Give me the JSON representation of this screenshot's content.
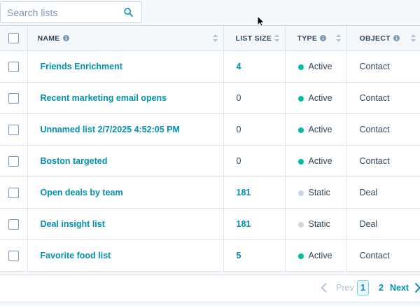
{
  "search": {
    "placeholder": "Search lists",
    "value": ""
  },
  "table": {
    "columns": [
      {
        "label": "NAME",
        "info": true
      },
      {
        "label": "LIST SIZE",
        "info": false
      },
      {
        "label": "TYPE",
        "info": true
      },
      {
        "label": "OBJECT",
        "info": true
      }
    ],
    "rows": [
      {
        "name": "Friends Enrichment",
        "size": "4",
        "size_link": true,
        "type": "Active",
        "object": "Contact"
      },
      {
        "name": "Recent marketing email opens",
        "size": "0",
        "size_link": false,
        "type": "Active",
        "object": "Contact"
      },
      {
        "name": "Unnamed list 2/7/2025 4:52:05 PM",
        "size": "0",
        "size_link": false,
        "type": "Active",
        "object": "Contact"
      },
      {
        "name": "Boston targeted",
        "size": "0",
        "size_link": false,
        "type": "Active",
        "object": "Contact"
      },
      {
        "name": "Open deals by team",
        "size": "181",
        "size_link": true,
        "type": "Static",
        "object": "Deal"
      },
      {
        "name": "Deal insight list",
        "size": "181",
        "size_link": true,
        "type": "Static",
        "object": "Deal"
      },
      {
        "name": "Favorite food list",
        "size": "5",
        "size_link": true,
        "type": "Active",
        "object": "Contact"
      }
    ]
  },
  "type_colors": {
    "Active": "#00bda5",
    "Static": "#cbd6e2"
  },
  "pagination": {
    "prev_label": "Prev",
    "current_page": "1",
    "next_page": "2",
    "next_label": "Next"
  }
}
